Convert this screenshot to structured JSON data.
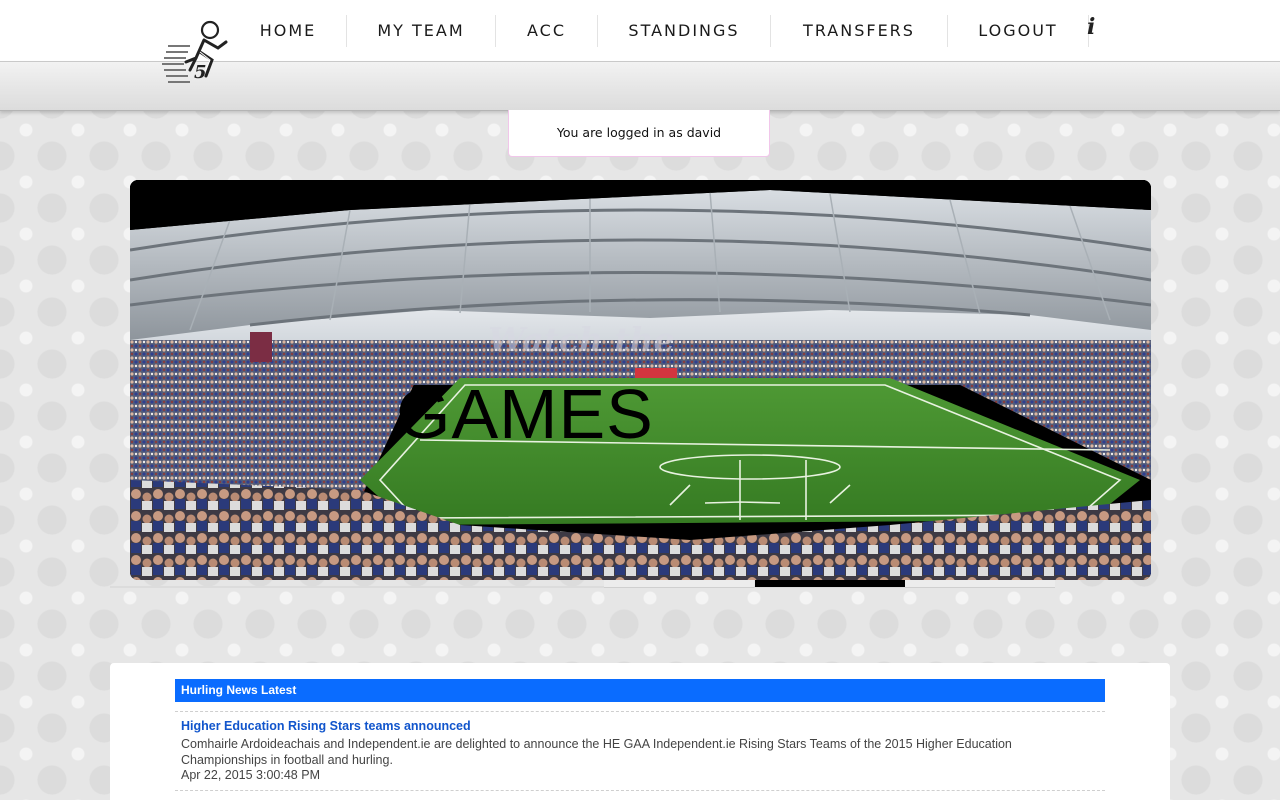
{
  "nav": {
    "items": [
      {
        "label": "HOME"
      },
      {
        "label": "MY TEAM"
      },
      {
        "label": "ACC"
      },
      {
        "label": "STANDINGS"
      },
      {
        "label": "TRANSFERS"
      },
      {
        "label": "LOGOUT"
      }
    ],
    "info_icon": "i",
    "logo_icon": "running-player-logo"
  },
  "login_status": "You are logged in as david",
  "hero": {
    "small_text": "Watch the",
    "big_text": "GAMES",
    "slides": 3,
    "active_slide": 2
  },
  "news": {
    "header": "Hurling News Latest",
    "items": [
      {
        "title": "Higher Education Rising Stars teams announced",
        "description": "Comhairle Ardoideachais and Independent.ie are delighted to announce the HE GAA Independent.ie Rising Stars Teams of the 2015 Higher Education Championships in football and hurling.",
        "date": "Apr 22, 2015 3:00:48 PM"
      }
    ]
  },
  "colors": {
    "news_header": "#0a6cff",
    "news_link": "#1155cc",
    "pitch": "#3f8f2a"
  }
}
